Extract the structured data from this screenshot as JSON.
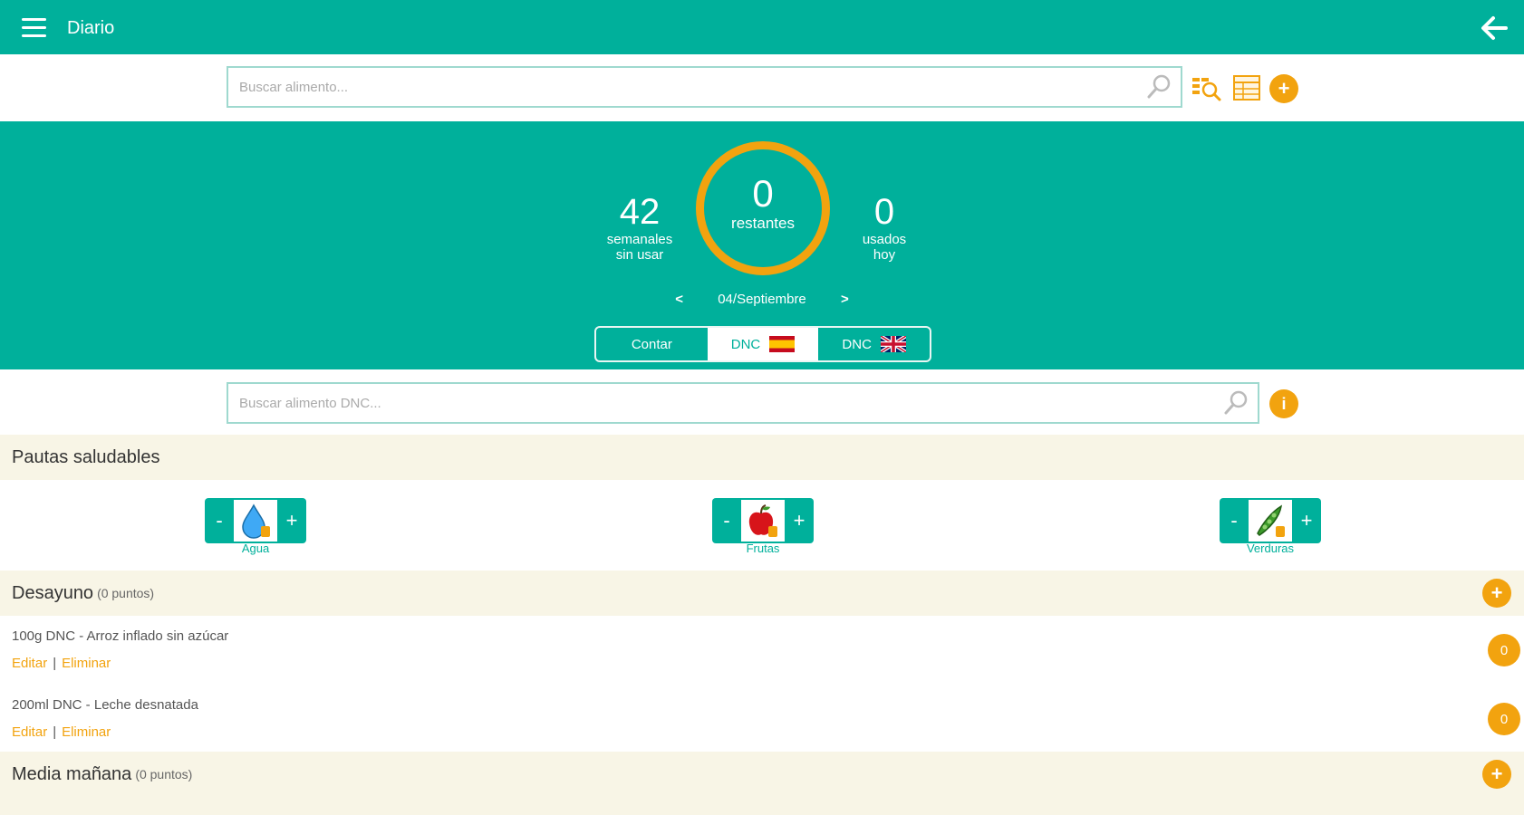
{
  "header": {
    "title": "Diario"
  },
  "search": {
    "placeholder": "Buscar alimento..."
  },
  "stats": {
    "weekly_value": "42",
    "weekly_label_1": "semanales",
    "weekly_label_2": "sin usar",
    "remaining_value": "0",
    "remaining_label": "restantes",
    "used_value": "0",
    "used_label_1": "usados",
    "used_label_2": "hoy"
  },
  "date_nav": {
    "prev": "<",
    "date": "04/Septiembre",
    "next": ">"
  },
  "tabs": {
    "contar": "Contar",
    "dnc_es": "DNC",
    "dnc_uk": "DNC"
  },
  "dnc_search": {
    "placeholder": "Buscar alimento DNC..."
  },
  "healthy": {
    "title": "Pautas saludables",
    "items": [
      {
        "label": "Agua",
        "minus": "-",
        "plus": "+"
      },
      {
        "label": "Frutas",
        "minus": "-",
        "plus": "+"
      },
      {
        "label": "Verduras",
        "minus": "-",
        "plus": "+"
      }
    ]
  },
  "meals": [
    {
      "title": "Desayuno",
      "points": "(0 puntos)",
      "items": [
        {
          "name": "100g DNC - Arroz inflado sin azúcar",
          "edit": "Editar",
          "sep": "|",
          "delete": "Eliminar",
          "points": "0"
        },
        {
          "name": "200ml DNC - Leche desnatada",
          "edit": "Editar",
          "sep": "|",
          "delete": "Eliminar",
          "points": "0"
        }
      ]
    },
    {
      "title": "Media mañana",
      "points": "(0 puntos)",
      "items": []
    }
  ],
  "colors": {
    "primary": "#00b09b",
    "accent": "#f2a30f",
    "section_bg": "#f8f5e6"
  }
}
